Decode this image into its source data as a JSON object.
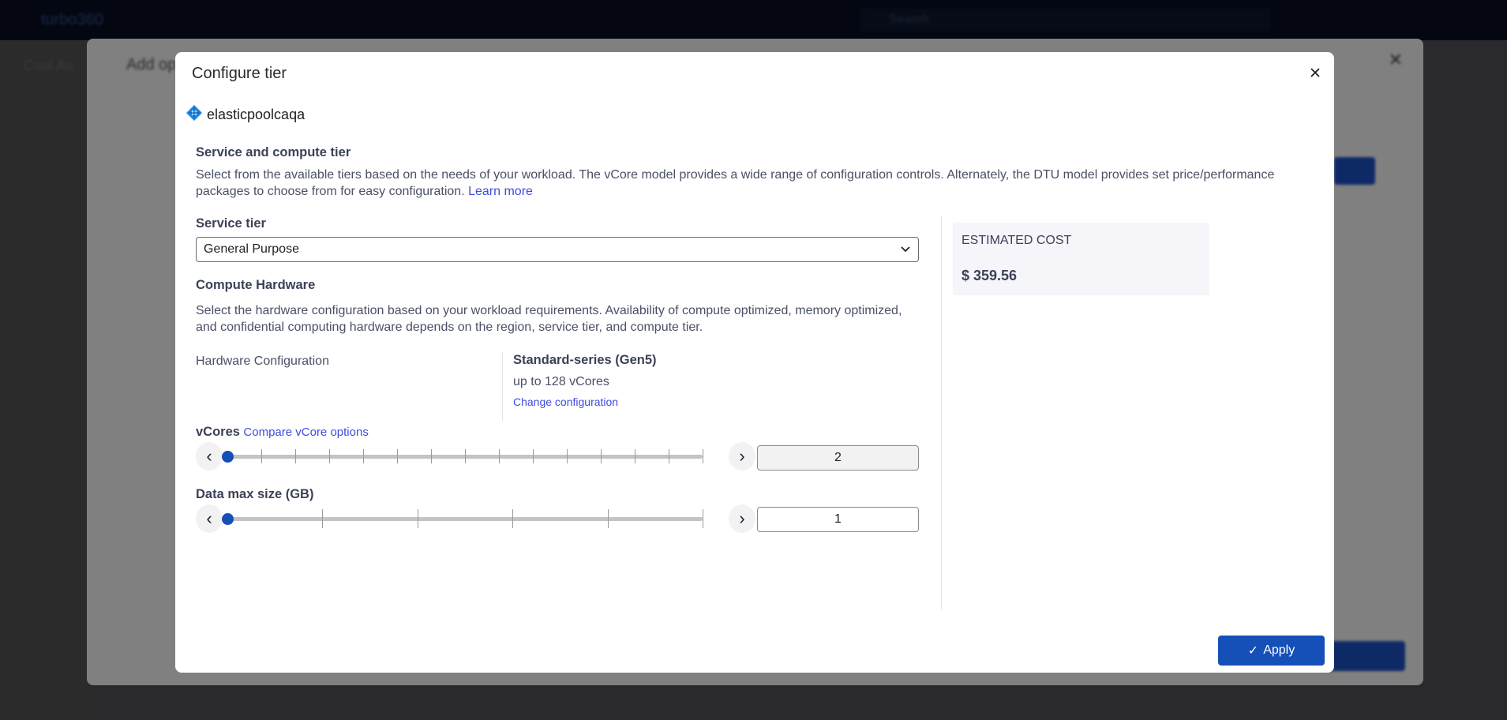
{
  "background": {
    "brand": "turbo360",
    "search_placeholder": "Search",
    "panel_title": "Add op",
    "left_title": "Cost An"
  },
  "modal": {
    "title": "Configure tier",
    "resource_name": "elasticpoolcaqa",
    "resource_icon": "sql-elastic-pool-icon",
    "service_section": {
      "heading": "Service and compute tier",
      "description": "Select from the available tiers based on the needs of your workload. The vCore model provides a wide range of configuration controls. Alternately, the DTU model provides set price/performance packages to choose from for easy configuration.",
      "learn_more": "Learn more"
    },
    "service_tier": {
      "label": "Service tier",
      "value": "General Purpose"
    },
    "compute_hardware": {
      "heading": "Compute Hardware",
      "description": "Select the hardware configuration based on your workload requirements. Availability of compute optimized, memory optimized, and confidential computing hardware depends on the region, service tier, and compute tier.",
      "config_label": "Hardware Configuration",
      "config_name": "Standard-series (Gen5)",
      "config_detail": "up to 128 vCores",
      "change_link": "Change configuration"
    },
    "vcores": {
      "label": "vCores",
      "compare_link": "Compare vCore options",
      "value": "2",
      "slider_fraction": 0
    },
    "data_max_size": {
      "label": "Data max size (GB)",
      "value": "1",
      "slider_fraction": 0
    },
    "estimated_cost": {
      "label": "ESTIMATED COST",
      "value": "$ 359.56"
    },
    "apply_label": "Apply"
  },
  "colors": {
    "accent": "#1450b8",
    "link": "#3d4ce0",
    "cost_bg": "#f5f5fa"
  }
}
